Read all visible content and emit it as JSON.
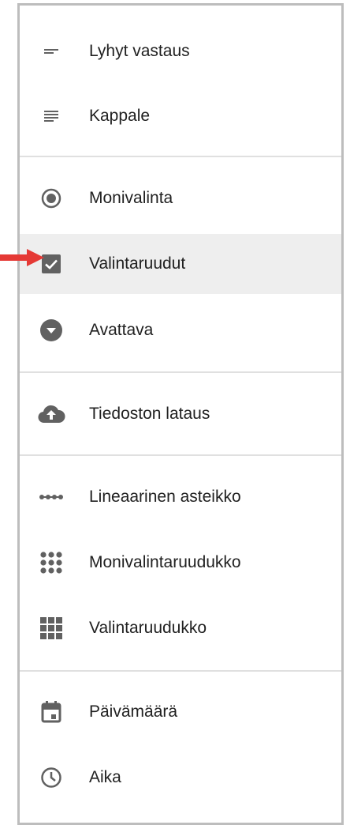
{
  "menu": {
    "items": [
      {
        "label": "Lyhyt vastaus",
        "icon": "short-text-icon"
      },
      {
        "label": "Kappale",
        "icon": "paragraph-icon"
      },
      {
        "label": "Monivalinta",
        "icon": "radio-button-icon"
      },
      {
        "label": "Valintaruudut",
        "icon": "checkbox-icon",
        "selected": true
      },
      {
        "label": "Avattava",
        "icon": "dropdown-icon"
      },
      {
        "label": "Tiedoston lataus",
        "icon": "cloud-upload-icon"
      },
      {
        "label": "Lineaarinen asteikko",
        "icon": "linear-scale-icon"
      },
      {
        "label": "Monivalintaruudukko",
        "icon": "dot-grid-icon"
      },
      {
        "label": "Valintaruudukko",
        "icon": "square-grid-icon"
      },
      {
        "label": "Päivämäärä",
        "icon": "calendar-icon"
      },
      {
        "label": "Aika",
        "icon": "clock-icon"
      }
    ]
  },
  "colors": {
    "icon": "#616161",
    "text": "#212121",
    "selected_bg": "#eeeeee",
    "divider": "#e0e0e0",
    "arrow": "#e53935"
  }
}
